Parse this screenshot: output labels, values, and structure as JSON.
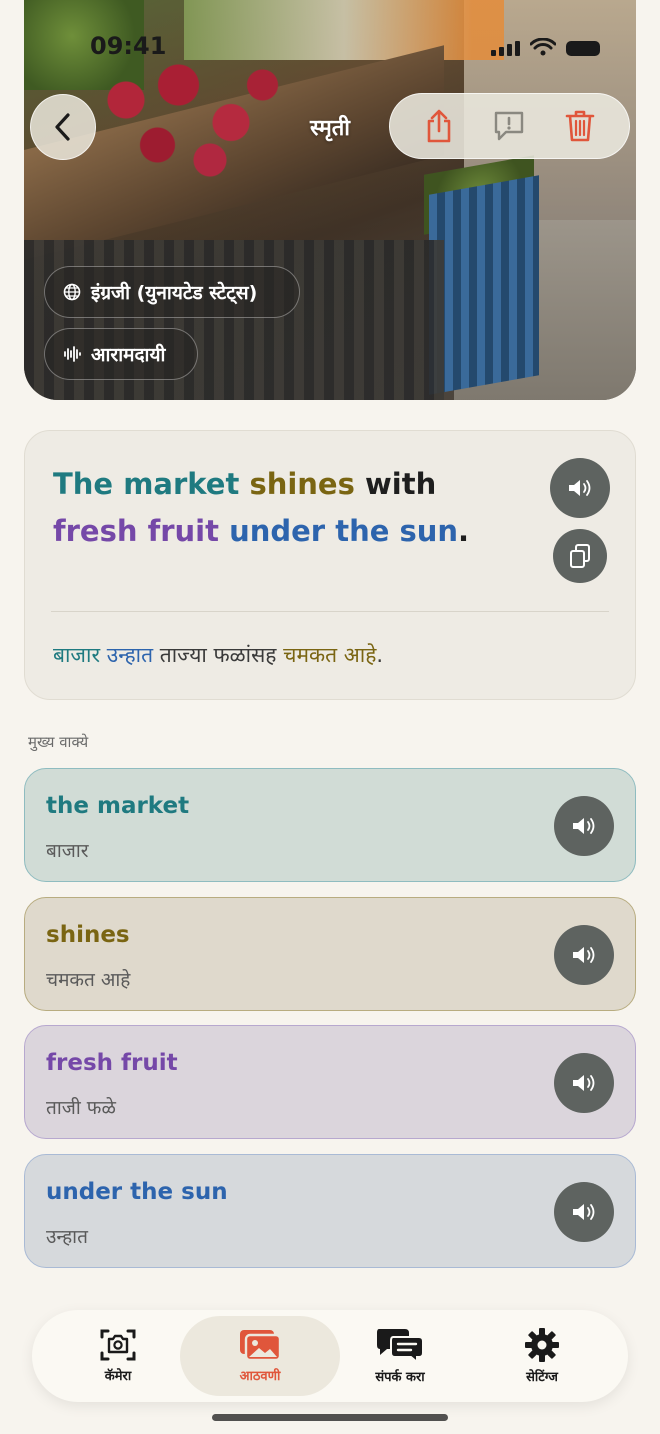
{
  "status": {
    "time": "09:41"
  },
  "header": {
    "title": "स्मृती"
  },
  "chips": {
    "language": "इंग्रजी (युनायटेड स्टेट्स)",
    "tone": "आरामदायी"
  },
  "sentence": {
    "en_parts": [
      "The market",
      " ",
      "shines",
      " with ",
      "fresh",
      " ",
      "fruit",
      " ",
      "under the sun",
      "."
    ],
    "mr_parts": [
      "बाजार",
      " ",
      "उन्हात",
      " ताज्या फळांसह ",
      "चमकत आहे",
      "."
    ]
  },
  "section_label": "मुख्य वाक्ये",
  "phrases": [
    {
      "en": "the market",
      "mr": "बाजार"
    },
    {
      "en": "shines",
      "mr": "चमकत आहे"
    },
    {
      "en": "fresh fruit",
      "mr": "ताजी फळे"
    },
    {
      "en": "under the sun",
      "mr": "उन्हात"
    }
  ],
  "tabs": [
    {
      "label": "कॅमेरा",
      "icon": "camera-icon"
    },
    {
      "label": "आठवणी",
      "icon": "photos-icon",
      "active": true
    },
    {
      "label": "संपर्क करा",
      "icon": "chat-icon"
    },
    {
      "label": "सेटिंग्ज",
      "icon": "gear-icon"
    }
  ],
  "colors": {
    "accent": "#e0563b",
    "teal": "#1f7a80",
    "olive": "#7a6512",
    "purple": "#7548a8",
    "blue": "#2d64ad"
  }
}
